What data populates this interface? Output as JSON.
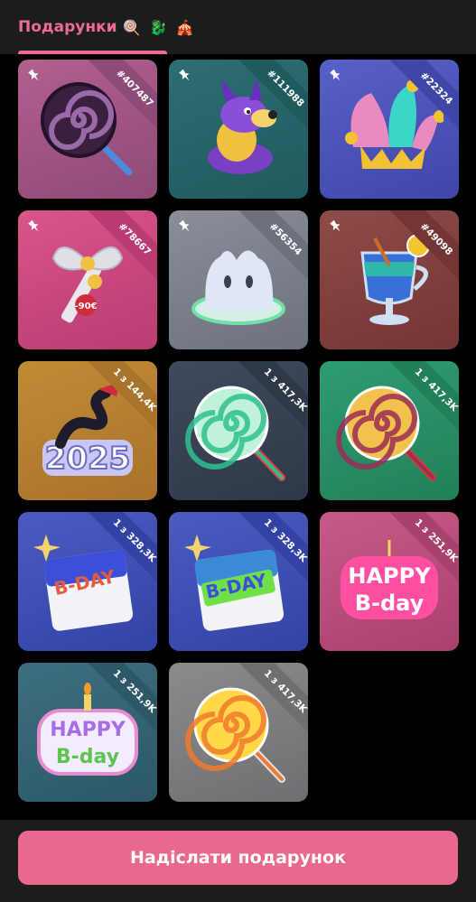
{
  "header": {
    "tab_label": "Подарунки",
    "tab_emoji": "🍭 🐉 🎪"
  },
  "gifts": [
    {
      "badge": "#407487",
      "bg": "#b25f8f",
      "ribbon": "#8e4a78",
      "pinned": true,
      "icon": "lollipop-purple-icon"
    },
    {
      "badge": "#111988",
      "bg": "#2d6e73",
      "ribbon": "#1f5a5e",
      "pinned": true,
      "icon": "dog-jester-icon"
    },
    {
      "badge": "#22324",
      "bg": "#5961c8",
      "ribbon": "#3e46a8",
      "pinned": true,
      "icon": "jester-hat-icon"
    },
    {
      "badge": "#78667",
      "bg": "#d9558a",
      "ribbon": "#b83c72",
      "pinned": true,
      "icon": "bow-key-icon"
    },
    {
      "badge": "#56354",
      "bg": "#8a8e99",
      "ribbon": "#6d717c",
      "pinned": true,
      "icon": "ghost-icon"
    },
    {
      "badge": "#49098",
      "bg": "#8e4b47",
      "ribbon": "#733634",
      "pinned": true,
      "icon": "cocktail-icon"
    },
    {
      "badge": "1 з 144,4K",
      "bg": "#c08b36",
      "ribbon": "#a8732a",
      "pinned": false,
      "icon": "snake-2025-icon"
    },
    {
      "badge": "1 з 417,3K",
      "bg": "#404a5c",
      "ribbon": "#2f3848",
      "pinned": false,
      "icon": "lollipop-green-icon"
    },
    {
      "badge": "1 з 417,3K",
      "bg": "#2f9c72",
      "ribbon": "#218058",
      "pinned": false,
      "icon": "lollipop-red-icon"
    },
    {
      "badge": "1 з 328,3K",
      "bg": "#4c5bc0",
      "ribbon": "#3442a6",
      "pinned": false,
      "icon": "calendar-bday-icon"
    },
    {
      "badge": "1 з 328,3K",
      "bg": "#4c5bc0",
      "ribbon": "#3442a6",
      "pinned": false,
      "icon": "calendar-bday-green-icon"
    },
    {
      "badge": "1 з 251,9K",
      "bg": "#c65a86",
      "ribbon": "#a9416d",
      "pinned": false,
      "icon": "happy-bday-pink-icon"
    },
    {
      "badge": "1 з 251,9K",
      "bg": "#3d6f80",
      "ribbon": "#2c5867",
      "pinned": false,
      "icon": "happy-bday-candle-icon"
    },
    {
      "badge": "1 з 417,3K",
      "bg": "#8b8b8e",
      "ribbon": "#6f6f72",
      "pinned": false,
      "icon": "lollipop-orange-icon"
    }
  ],
  "art_text": {
    "price_tag": "-90€",
    "year": "2025",
    "bday": "B-DAY",
    "happy": "HAPPY",
    "bday_short": "B-day"
  },
  "footer": {
    "send_label": "Надіслати подарунок"
  }
}
